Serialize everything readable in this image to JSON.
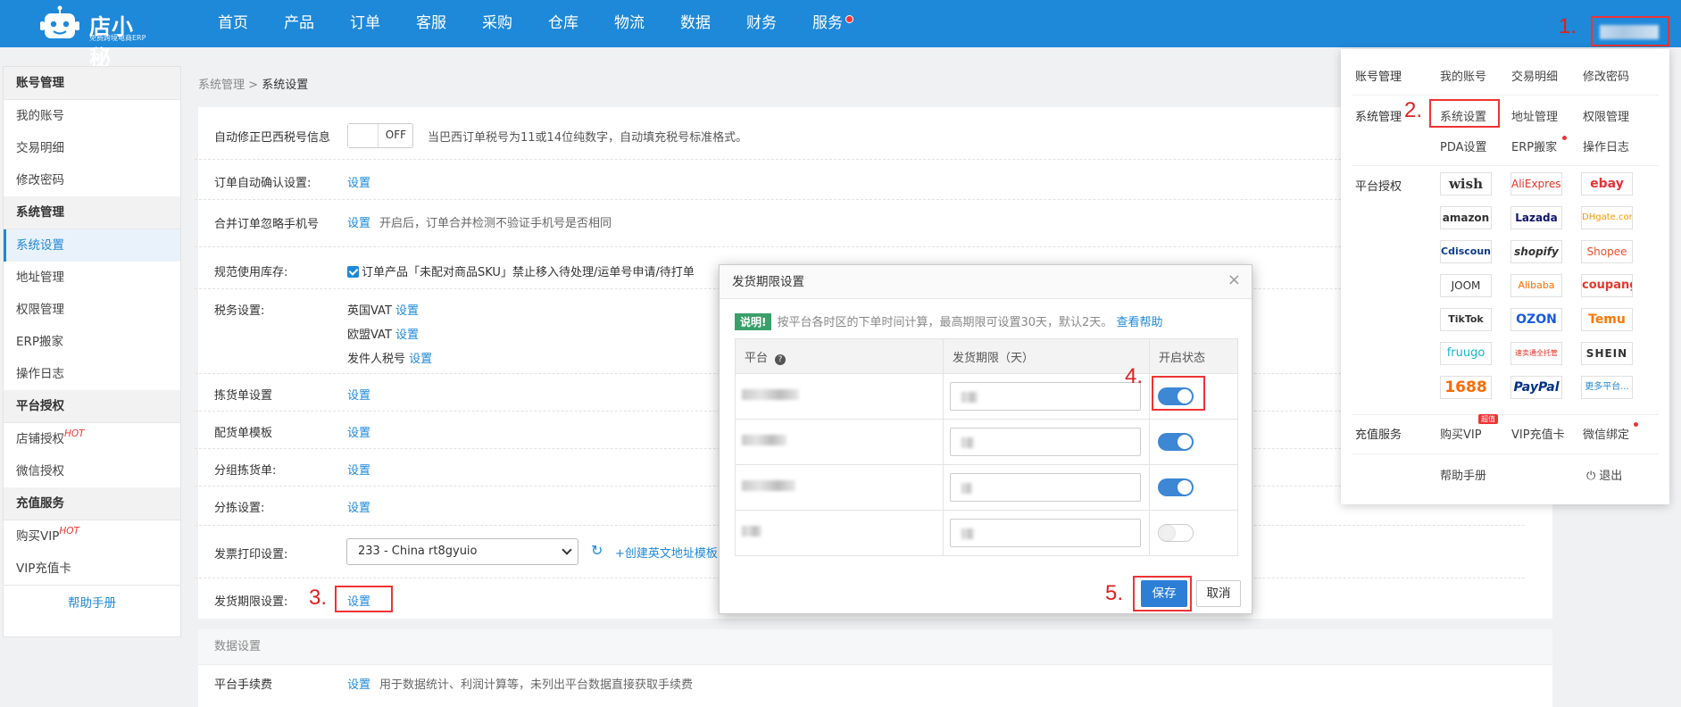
{
  "logo": {
    "name": "店小秘",
    "slogan": "免费跨境电商ERP"
  },
  "nav": [
    "首页",
    "产品",
    "订单",
    "客服",
    "采购",
    "仓库",
    "物流",
    "数据",
    "财务",
    "服务"
  ],
  "steps": [
    "1.",
    "2.",
    "3.",
    "4.",
    "5."
  ],
  "sidebar": {
    "groups": [
      {
        "title": "账号管理",
        "items": [
          "我的账号",
          "交易明细",
          "修改密码"
        ]
      },
      {
        "title": "系统管理",
        "items": [
          "系统设置",
          "地址管理",
          "权限管理",
          "ERP搬家",
          "操作日志"
        ]
      },
      {
        "title": "平台授权",
        "items": [
          "店铺授权",
          "微信授权"
        ]
      },
      {
        "title": "充值服务",
        "items": [
          "购买VIP",
          "VIP充值卡"
        ]
      }
    ],
    "hot": "HOT",
    "help": "帮助手册"
  },
  "breadcrumb": {
    "parent": "系统管理",
    "sep": ">",
    "current": "系统设置"
  },
  "settings": {
    "brazil_label": "自动修正巴西税号信息",
    "brazil_toggle": "OFF",
    "brazil_hint": "当巴西订单税号为11或14位纯数字，自动填充税号标准格式。",
    "auto_confirm_label": "订单自动确认设置:",
    "merge_label": "合并订单忽略手机号",
    "merge_hint": "开启后，订单合并检测不验证手机号是否相同",
    "stock_label": "规范使用库存:",
    "stock_text": "订单产品「未配对商品SKU」禁止移入待处理/运单号申请/待打单",
    "tax_label": "税务设置:",
    "tax_uk": "英国VAT",
    "tax_eu": "欧盟VAT",
    "tax_sender": "发件人税号",
    "picking_label": "拣货单设置",
    "packing_label": "配货单模板",
    "group_picking_label": "分组拣货单:",
    "sorting_label": "分拣设置:",
    "invoice_label": "发票打印设置:",
    "invoice_select": "233 - China rt8gyuio",
    "invoice_link": "+创建英文地址模板",
    "shipping_label": "发货期限设置:",
    "set_link": "设置"
  },
  "data_settings": {
    "header": "数据设置",
    "fee_label": "平台手续费",
    "fee_link": "设置",
    "fee_hint": "用于数据统计、利润计算等，未列出平台数据直接获取手续费"
  },
  "dropdown": {
    "account": {
      "title": "账号管理",
      "items": [
        "我的账号",
        "交易明细",
        "修改密码"
      ]
    },
    "system": {
      "title": "系统管理",
      "items": [
        "系统设置",
        "地址管理",
        "权限管理",
        "PDA设置",
        "ERP搬家",
        "操作日志"
      ]
    },
    "platform": {
      "title": "平台授权",
      "logos": [
        "wish",
        "AliExpress",
        "ebay",
        "amazon",
        "Lazada",
        "DHgate.com",
        "Cdiscount",
        "shopify",
        "Shopee",
        "JOOM",
        "Alibaba",
        "coupang",
        "TikTok",
        "OZON",
        "Temu",
        "fruugo",
        "速卖通全托管",
        "SHEIN",
        "1688",
        "PayPal",
        "更多平台..."
      ]
    },
    "recharge": {
      "title": "充值服务",
      "items": [
        "购买VIP",
        "VIP充值卡",
        "微信绑定"
      ],
      "badge": "超值"
    },
    "help": "帮助手册",
    "logout": "退出"
  },
  "modal": {
    "title": "发货期限设置",
    "note_tag": "说明!",
    "note_text": "按平台各时区的下单时间计算，最高期限可设置30天，默认2天。",
    "note_link": "查看帮助",
    "headers": [
      "平台",
      "发货期限（天）",
      "开启状态"
    ],
    "rows": [
      {
        "enabled": true
      },
      {
        "enabled": true
      },
      {
        "enabled": true
      },
      {
        "enabled": false
      }
    ],
    "save": "保存",
    "cancel": "取消"
  }
}
